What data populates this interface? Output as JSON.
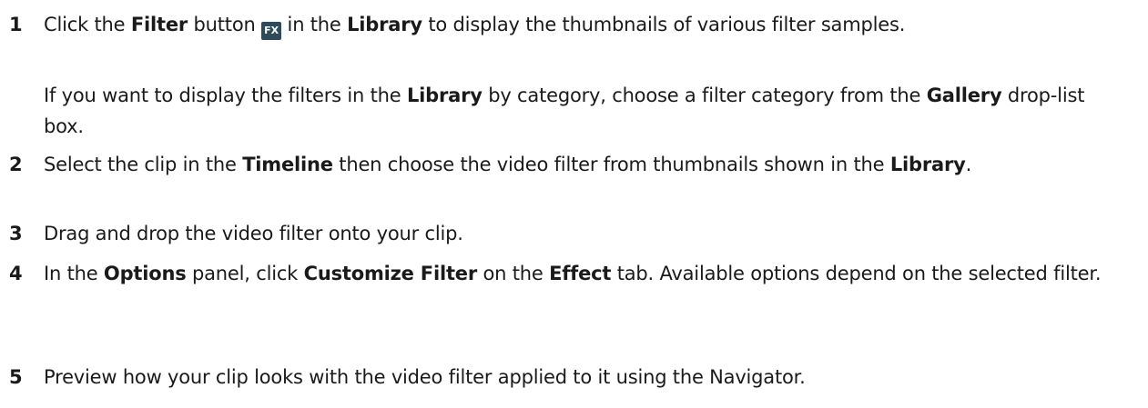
{
  "steps": [
    {
      "number": "1",
      "p1": {
        "t1": "Click the ",
        "b1": "Filter",
        "t2": " button ",
        "icon": "FX",
        "t3": " in the ",
        "b2": "Library",
        "t4": " to display the thumbnails of various filter samples."
      },
      "p2": {
        "t1": "If you want to display the filters in the ",
        "b1": "Library",
        "t2": " by category, choose a filter category from the ",
        "b2": "Gallery",
        "t3": " drop-list box."
      }
    },
    {
      "number": "2",
      "t1": "Select the clip in the ",
      "b1": "Timeline",
      "t2": " then choose the video filter from thumbnails shown in the ",
      "b2": "Library",
      "t3": "."
    },
    {
      "number": "3",
      "t1": "Drag and drop the video filter onto your clip."
    },
    {
      "number": "4",
      "t1": "In the ",
      "b1": "Options",
      "t2": " panel, click ",
      "b2": "Customize Filter",
      "t3": " on the ",
      "b3": "Effect",
      "t4": " tab. Available options depend on the selected filter."
    },
    {
      "number": "5",
      "t1": "Preview how your clip looks with the video filter applied to it using the Navigator."
    }
  ]
}
